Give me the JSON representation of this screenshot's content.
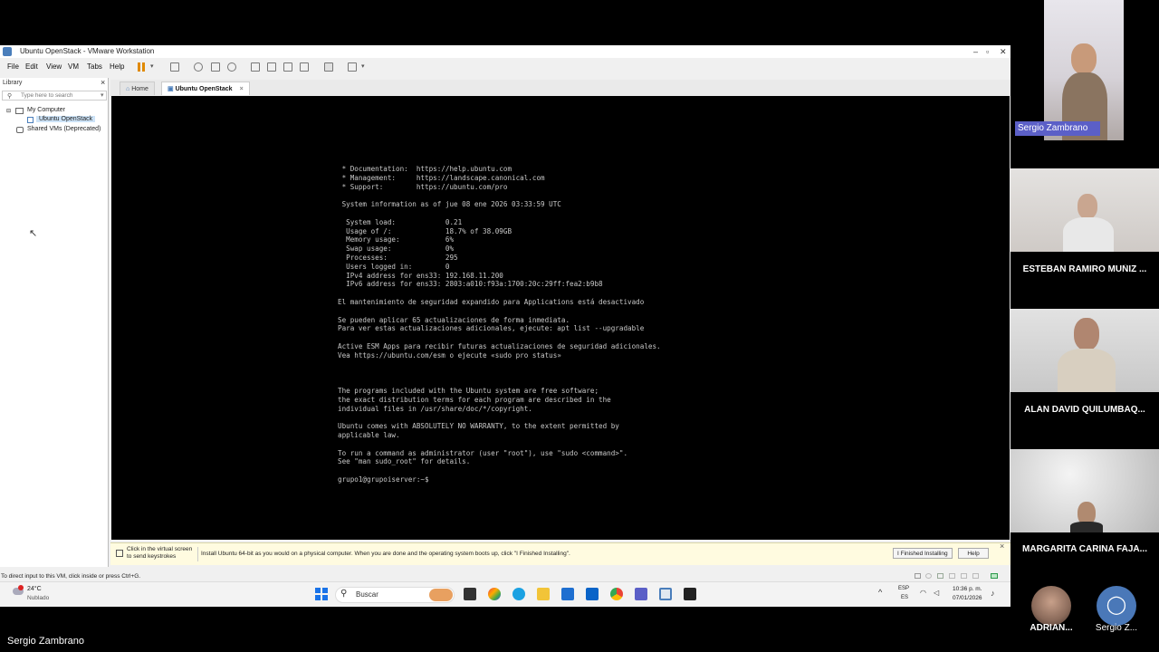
{
  "window": {
    "title": "Ubuntu OpenStack - VMware Workstation",
    "controls": [
      "–",
      "▫",
      "✕"
    ]
  },
  "menu": [
    "File",
    "Edit",
    "View",
    "VM",
    "Tabs",
    "Help"
  ],
  "library": {
    "header": "Library",
    "search_placeholder": "Type here to search",
    "tree": [
      "My Computer",
      "Ubuntu OpenStack",
      "Shared VMs (Deprecated)"
    ]
  },
  "tabs": [
    "Home",
    "Ubuntu OpenStack"
  ],
  "terminal": {
    "lines": [
      " * Documentation:  https://help.ubuntu.com",
      " * Management:     https://landscape.canonical.com",
      " * Support:        https://ubuntu.com/pro",
      "",
      " System information as of jue 08 ene 2026 03:33:59 UTC",
      "",
      "  System load:            0.21",
      "  Usage of /:             18.7% of 38.09GB",
      "  Memory usage:           6%",
      "  Swap usage:             0%",
      "  Processes:              295",
      "  Users logged in:        0",
      "  IPv4 address for ens33: 192.168.11.200",
      "  IPv6 address for ens33: 2803:a010:f93a:1700:20c:29ff:fea2:b9b8",
      "",
      "El mantenimiento de seguridad expandido para Applications está desactivado",
      "",
      "Se pueden aplicar 65 actualizaciones de forma inmediata.",
      "Para ver estas actualizaciones adicionales, ejecute: apt list --upgradable",
      "",
      "Active ESM Apps para recibir futuras actualizaciones de seguridad adicionales.",
      "Vea https://ubuntu.com/esm o ejecute «sudo pro status»",
      "",
      "",
      "",
      "The programs included with the Ubuntu system are free software;",
      "the exact distribution terms for each program are described in the",
      "individual files in /usr/share/doc/*/copyright.",
      "",
      "Ubuntu comes with ABSOLUTELY NO WARRANTY, to the extent permitted by",
      "applicable law.",
      "",
      "To run a command as administrator (user \"root\"), use \"sudo <command>\".",
      "See \"man sudo_root\" for details.",
      "",
      "grupo1@grupoiserver:~$ "
    ]
  },
  "hint": {
    "click_text_1": "Click in the virtual screen",
    "click_text_2": "to send keystrokes",
    "message": "Install Ubuntu 64-bit as you would on a physical computer. When you are done and the operating system boots up, click \"I Finished Installing\".",
    "finished_button": "I Finished Installing",
    "help_button": "Help"
  },
  "status_text": "To direct input to this VM, click inside or press Ctrl+G.",
  "taskbar": {
    "weather_temp": "24°C",
    "weather_desc": "Nublado",
    "search": "Buscar",
    "lang_1": "ESP",
    "lang_2": "ES",
    "time": "10:36 p. m.",
    "date": "07/01/2026"
  },
  "participants": [
    {
      "name": "Sergio Zambrano"
    },
    {
      "name": "ESTEBAN RAMIRO MUÑIZ ..."
    },
    {
      "name": "ALAN DAVID QUILUMBAQ..."
    },
    {
      "name": "MARGARITA CARINA FAJA..."
    },
    {
      "name": "ADRIAN..."
    },
    {
      "name": "Sergio Z..."
    }
  ],
  "presenter_label": "Sergio Zambrano"
}
